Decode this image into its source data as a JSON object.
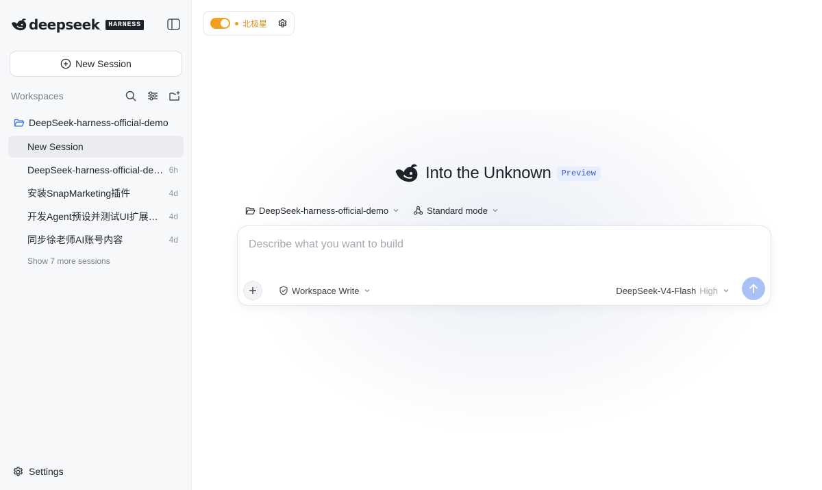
{
  "sidebar": {
    "brand": {
      "name": "deepseek",
      "badge": "HARNESS",
      "logo_icon": "deepseek-whale-icon"
    },
    "panel_toggle_icon": "sidebar-panel-icon",
    "new_session": {
      "label": "New Session",
      "icon": "plus-circle-icon"
    },
    "workspaces": {
      "title": "Workspaces",
      "tools": [
        "search-icon",
        "sliders-icon",
        "new-folder-icon"
      ]
    },
    "workspace": {
      "name": "DeepSeek-harness-official-demo",
      "icon": "folder-open-icon"
    },
    "sessions": [
      {
        "title": "New Session",
        "time": "",
        "active": true
      },
      {
        "title": "DeepSeek-harness-official-demo",
        "time": "6h",
        "active": false
      },
      {
        "title": "安装SnapMarketing插件",
        "time": "4d",
        "active": false
      },
      {
        "title": "开发Agent预设并测试UI扩展功能",
        "time": "4d",
        "active": false
      },
      {
        "title": "同步徐老师AI账号内容",
        "time": "4d",
        "active": false
      }
    ],
    "show_more": "Show 7 more sessions",
    "settings": {
      "label": "Settings",
      "icon": "gear-icon"
    }
  },
  "topbar": {
    "mode_toggle_on": true,
    "mode_name": "北极星",
    "mode_settings_icon": "gear-icon"
  },
  "hero": {
    "title": "Into the Unknown",
    "badge": "Preview"
  },
  "composer": {
    "workspace": "DeepSeek-harness-official-demo",
    "mode": "Standard mode",
    "placeholder": "Describe what you want to build",
    "permission": "Workspace Write",
    "model": "DeepSeek-V4-Flash",
    "effort": "High"
  },
  "colors": {
    "accent_orange": "#f0a020",
    "send_button": "#a9c1f5",
    "preview_badge_bg": "#e7eeff",
    "folder_blue": "#3a78f0",
    "sidebar_bg": "#f7f8fa"
  }
}
